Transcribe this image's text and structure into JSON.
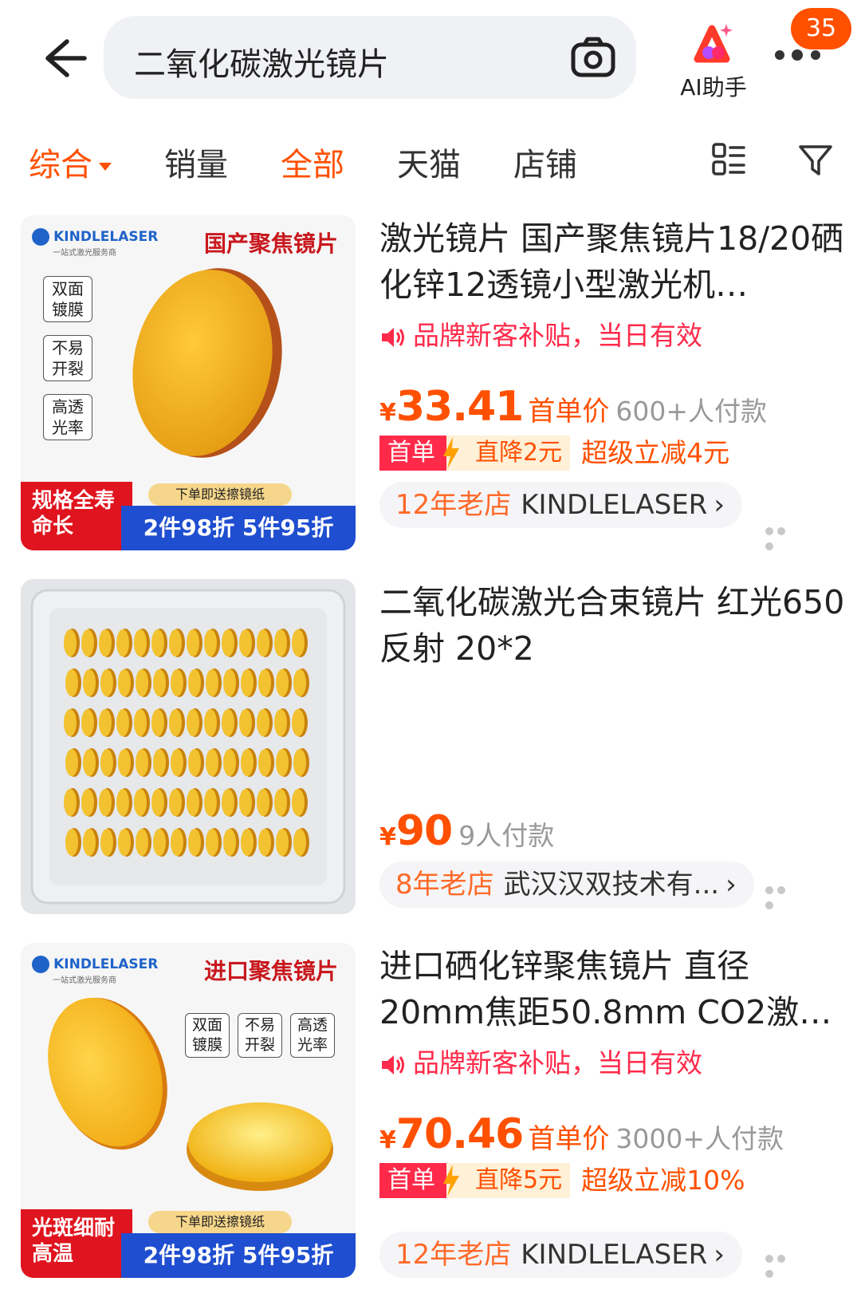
{
  "search": {
    "query": "二氧化碳激光镜片"
  },
  "header": {
    "ai_label": "AI助手",
    "notif_count": "35"
  },
  "tabs": {
    "items": [
      "综合",
      "销量",
      "全部",
      "天猫",
      "店铺"
    ]
  },
  "colors": {
    "accent": "#ff5000",
    "promo": "#ff2a4a",
    "muted": "#999999"
  },
  "products": [
    {
      "title": "激光镜片 国产聚焦镜片18/20硒化锌12透镜小型激光机…",
      "promo": "品牌新客补贴，当日有效",
      "yen": "¥",
      "price": "33.41",
      "price_label": "首单价",
      "sales": "600+人付款",
      "tag_first": "首单",
      "tag_drop": "直降2元",
      "tag_super": "超级立减4元",
      "shop_age": "12年老店",
      "shop_name": "KINDLELASER",
      "chevron": "›",
      "img": {
        "brand": "KINDLELASER",
        "brand_sub": "一站式激光服务商",
        "headline": "国产聚焦镜片",
        "badges": [
          "双面镀膜",
          "不易开裂",
          "高透光率"
        ],
        "corner": "规格全寿命长",
        "ribbon_top": "下单即送擦镜纸",
        "ribbon": "2件98折 5件95折"
      }
    },
    {
      "title": "二氧化碳激光合束镜片 红光650反射 20*2",
      "yen": "¥",
      "price": "90",
      "sales": "9人付款",
      "shop_age": "8年老店",
      "shop_name": "武汉汉双技术有...",
      "chevron": "›"
    },
    {
      "title": "进口硒化锌聚焦镜片 直径20mm焦距50.8mm CO2激…",
      "promo": "品牌新客补贴，当日有效",
      "yen": "¥",
      "price": "70.46",
      "price_label": "首单价",
      "sales": "3000+人付款",
      "tag_first": "首单",
      "tag_drop": "直降5元",
      "tag_super": "超级立减10%",
      "shop_age": "12年老店",
      "shop_name": "KINDLELASER",
      "chevron": "›",
      "img": {
        "brand": "KINDLELASER",
        "brand_sub": "一站式激光服务商",
        "headline": "进口聚焦镜片",
        "badges": [
          "双面镀膜",
          "不易开裂",
          "高透光率"
        ],
        "corner": "光斑细耐高温",
        "ribbon_top": "下单即送擦镜纸",
        "ribbon": "2件98折 5件95折"
      }
    }
  ]
}
